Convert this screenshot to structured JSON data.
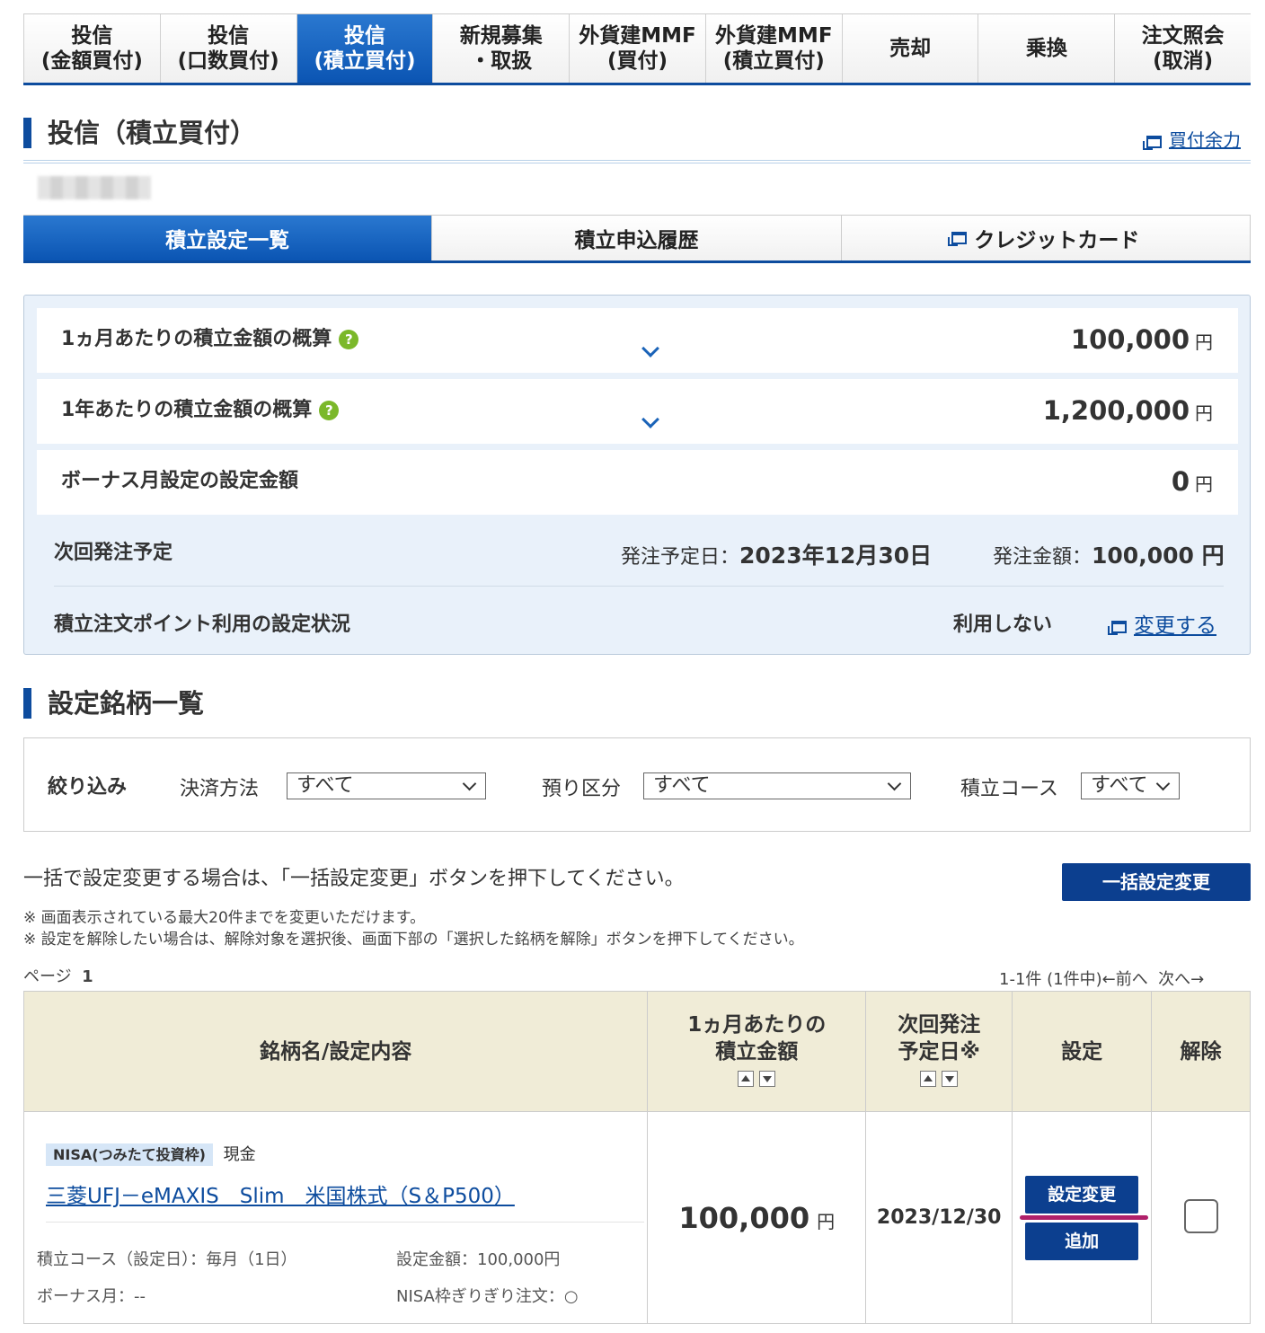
{
  "top_tabs": [
    {
      "line1": "投信",
      "line2": "(金額買付)"
    },
    {
      "line1": "投信",
      "line2": "(口数買付)"
    },
    {
      "line1": "投信",
      "line2": "(積立買付)"
    },
    {
      "line1": "新規募集",
      "line2": "・取扱"
    },
    {
      "line1": "外貨建MMF",
      "line2": "(買付)"
    },
    {
      "line1": "外貨建MMF",
      "line2": "(積立買付)"
    },
    {
      "line1": "売却",
      "line2": ""
    },
    {
      "line1": "乗換",
      "line2": ""
    },
    {
      "line1": "注文照会",
      "line2": "(取消)"
    }
  ],
  "page_title": "投信（積立買付）",
  "buying_power_link": "買付余力",
  "sub_tabs": [
    "積立設定一覧",
    "積立申込履歴",
    "クレジットカード"
  ],
  "summary": {
    "monthly_label": "1ヵ月あたりの積立金額の概算",
    "monthly_amount": "100,000",
    "yearly_label": "1年あたりの積立金額の概算",
    "yearly_amount": "1,200,000",
    "bonus_label": "ボーナス月設定の設定金額",
    "bonus_amount": "0",
    "yen": "円",
    "next_order_label": "次回発注予定",
    "order_date_label": "発注予定日：",
    "order_date": "2023年12月30日",
    "order_amount_label": "発注金額：",
    "order_amount": "100,000 円",
    "point_label": "積立注文ポイント利用の設定状況",
    "point_status": "利用しない",
    "point_change_link": "変更する"
  },
  "list_title": "設定銘柄一覧",
  "filter": {
    "label": "絞り込み",
    "payment_label": "決済方法",
    "payment_value": "すべて",
    "account_label": "預り区分",
    "account_value": "すべて",
    "course_label": "積立コース",
    "course_value": "すべて"
  },
  "bulk": {
    "instruction": "一括で設定変更する場合は、「一括設定変更」ボタンを押下してください。",
    "button": "一括設定変更",
    "note1": "※ 画面表示されている最大20件までを変更いただけます。",
    "note2": "※ 設定を解除したい場合は、解除対象を選択後、画面下部の「選択した銘柄を解除」ボタンを押下してください。"
  },
  "pagination": {
    "page_label": "ページ",
    "page_number": "1",
    "range": "1-1件 (1件中)",
    "prev": "←前へ",
    "next": "次へ→"
  },
  "table": {
    "headers": {
      "name": "銘柄名/設定内容",
      "monthly_line1": "1ヵ月あたりの",
      "monthly_line2": "積立金額",
      "next_line1": "次回発注",
      "next_line2": "予定日※",
      "setting": "設定",
      "cancel": "解除"
    },
    "row": {
      "badge": "NISA(つみたて投資枠)",
      "payment": "現金",
      "fund_name": "三菱UFJ－eMAXIS　Slim　米国株式（S＆P500）",
      "course": "積立コース（設定日）：毎月（1日）",
      "set_amount": "設定金額：100,000円",
      "bonus": "ボーナス月：--",
      "nisa_order": "NISA枠ぎりぎり注文：○",
      "amount": "100,000",
      "yen": "円",
      "next_date": "2023/12/30",
      "change_button": "設定変更",
      "add_button": "追加"
    }
  },
  "colors": {
    "primary": "#0d4c9e",
    "active_tab": "#1a63b8",
    "header_bg": "#f0ecd7",
    "highlight_underline": "#b0206a"
  }
}
